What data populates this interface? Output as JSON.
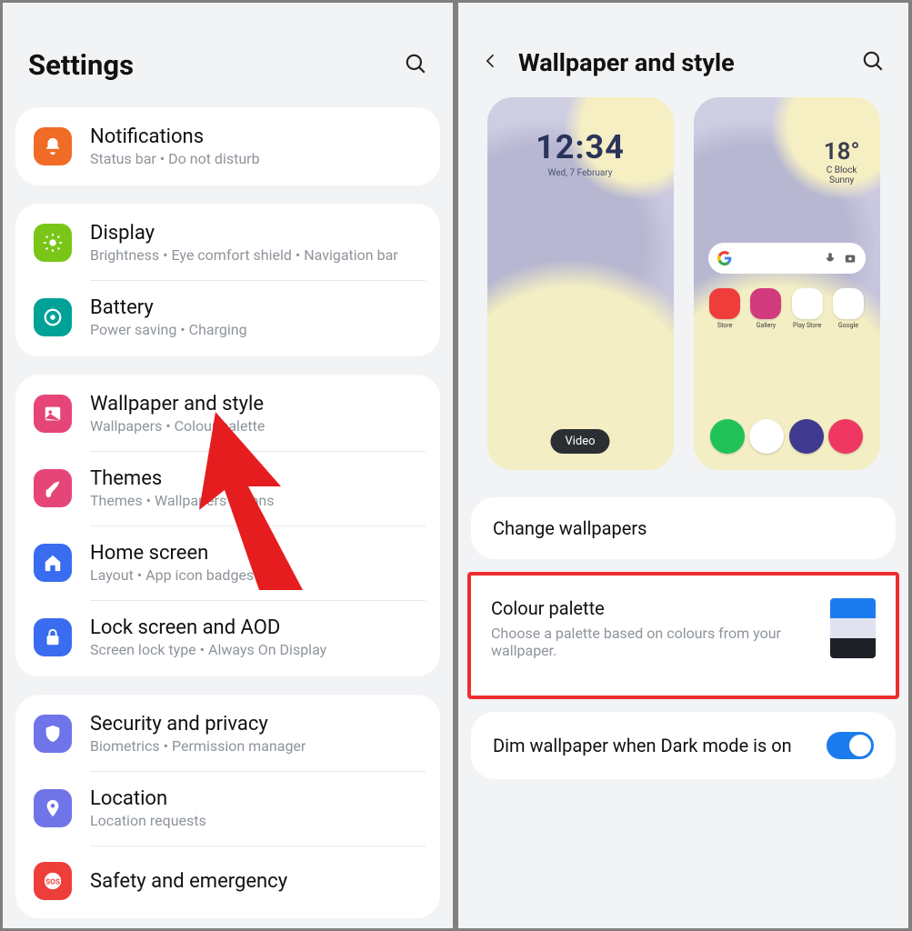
{
  "left": {
    "title": "Settings",
    "groups": [
      [
        {
          "icon": "bell",
          "color": "#f06b25",
          "title": "Notifications",
          "sub": "Status bar  •  Do not disturb"
        }
      ],
      [
        {
          "icon": "sun",
          "color": "#79c618",
          "title": "Display",
          "sub": "Brightness  •  Eye comfort shield  •  Navigation bar"
        },
        {
          "icon": "battery",
          "color": "#00a196",
          "title": "Battery",
          "sub": "Power saving  •  Charging"
        }
      ],
      [
        {
          "icon": "image",
          "color": "#e64578",
          "title": "Wallpaper and style",
          "sub": "Wallpapers  •  Colour palette"
        },
        {
          "icon": "brush",
          "color": "#e64578",
          "title": "Themes",
          "sub": "Themes  •  Wallpapers  •  Icons"
        },
        {
          "icon": "home",
          "color": "#3a6cf0",
          "title": "Home screen",
          "sub": "Layout  •  App icon badges"
        },
        {
          "icon": "lock",
          "color": "#3a6cf0",
          "title": "Lock screen and AOD",
          "sub": "Screen lock type  •  Always On Display"
        }
      ],
      [
        {
          "icon": "shield",
          "color": "#6f74e8",
          "title": "Security and privacy",
          "sub": "Biometrics  •  Permission manager"
        },
        {
          "icon": "pin",
          "color": "#6f74e8",
          "title": "Location",
          "sub": "Location requests"
        },
        {
          "icon": "sos",
          "color": "#ee3e3b",
          "title": "Safety and emergency",
          "sub": ""
        }
      ]
    ]
  },
  "right": {
    "title": "Wallpaper and style",
    "lock": {
      "time": "12:34",
      "date": "Wed, 7 February",
      "chip": "Video"
    },
    "home": {
      "weather": {
        "temp": "18°",
        "loc": "C Block",
        "cond": "Sunny"
      },
      "apps": [
        {
          "label": "Store",
          "color": "#ef3d3b"
        },
        {
          "label": "Gallery",
          "color": "#d13b7d"
        },
        {
          "label": "Play Store",
          "color": "#ffffff"
        },
        {
          "label": "Google",
          "color": "#ffffff"
        }
      ],
      "dock_colors": [
        "#21c15a",
        "#ffffff",
        "#3f3a8f",
        "#ef3762"
      ]
    },
    "change": "Change wallpapers",
    "palette": {
      "title": "Colour palette",
      "desc": "Choose a palette based on colours from your wallpaper.",
      "swatch": [
        "#1c7ced",
        "#e1e3f0",
        "#1d2026"
      ]
    },
    "dim": {
      "label": "Dim wallpaper when Dark mode is on",
      "on": true
    }
  }
}
